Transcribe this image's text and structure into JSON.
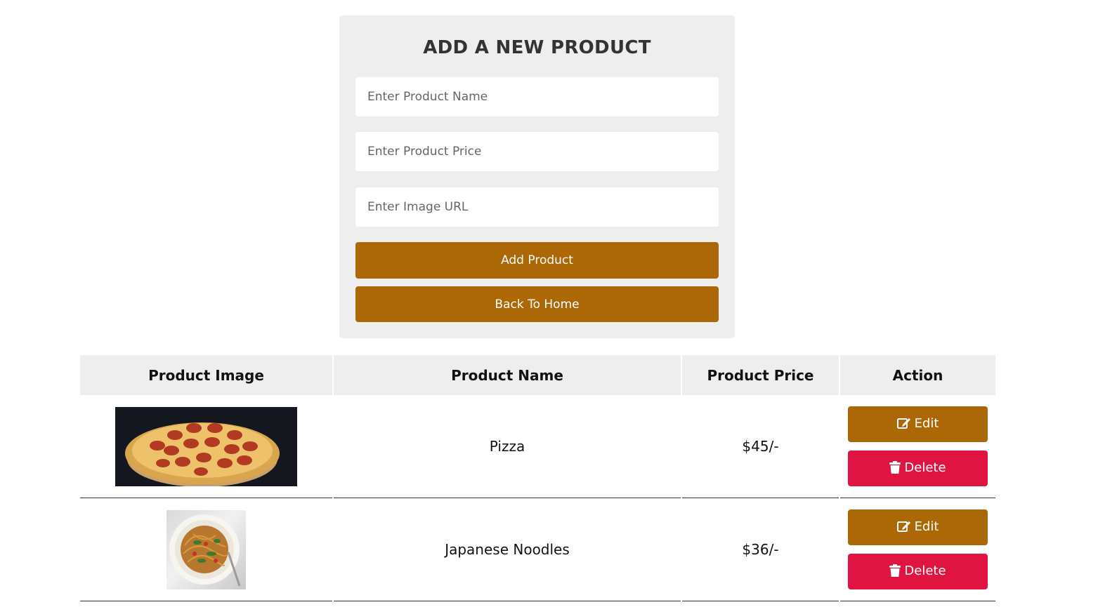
{
  "form": {
    "title": "ADD A NEW PRODUCT",
    "name_placeholder": "Enter Product Name",
    "price_placeholder": "Enter Product Price",
    "image_placeholder": "Enter Image URL",
    "add_label": "Add Product",
    "back_label": "Back To Home"
  },
  "table": {
    "headers": [
      "Product Image",
      "Product Name",
      "Product Price",
      "Action"
    ],
    "rows": [
      {
        "image": "pizza-photo",
        "name": "Pizza",
        "price": "$45/-",
        "edit_label": "Edit",
        "delete_label": "Delete"
      },
      {
        "image": "noodles-photo",
        "name": "Japanese Noodles",
        "price": "$36/-",
        "edit_label": "Edit",
        "delete_label": "Delete"
      }
    ]
  },
  "colors": {
    "accent": "#ac6806",
    "danger": "#df1440",
    "panel": "#eeeeee"
  }
}
